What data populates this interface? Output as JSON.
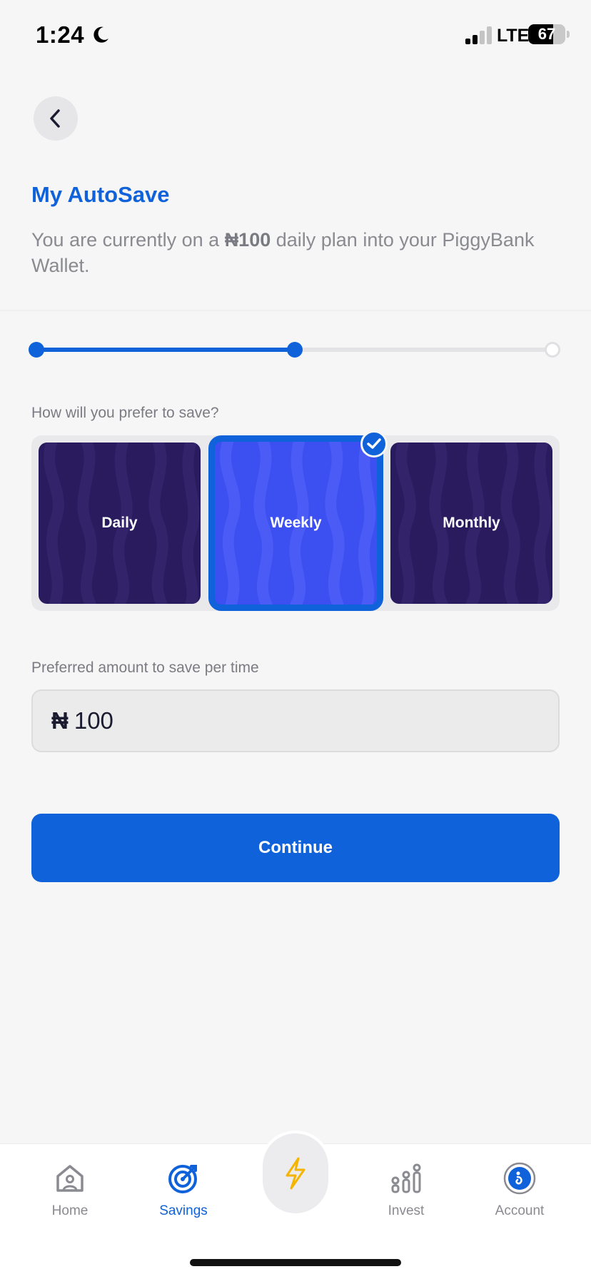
{
  "status_bar": {
    "time": "1:24",
    "network": "LTE",
    "battery": "67",
    "battery_percent": 67
  },
  "header": {
    "title": "My AutoSave",
    "description_prefix": "You are currently on a ",
    "description_amount": "₦100",
    "description_suffix": " daily plan into your PiggyBank Wallet."
  },
  "progress": {
    "current_step": 2,
    "total_steps": 3,
    "fraction": 0.5
  },
  "frequency": {
    "label": "How will you prefer to save?",
    "options": [
      {
        "label": "Daily",
        "selected": false
      },
      {
        "label": "Weekly",
        "selected": true
      },
      {
        "label": "Monthly",
        "selected": false
      }
    ]
  },
  "amount": {
    "label": "Preferred amount to save per time",
    "currency": "₦",
    "value": "100"
  },
  "continue_label": "Continue",
  "colors": {
    "accent": "#0f62d9",
    "card_dark": "#2a1a5e",
    "card_selected": "#3c4ff0",
    "fab_bolt": "#f5b400"
  },
  "nav": {
    "items": [
      {
        "label": "Home",
        "icon": "home-icon",
        "active": false
      },
      {
        "label": "Savings",
        "icon": "target-icon",
        "active": true
      },
      {
        "label": "Invest",
        "icon": "invest-icon",
        "active": false
      },
      {
        "label": "Account",
        "icon": "account-icon",
        "active": false
      }
    ],
    "center_icon": "lightning-icon"
  }
}
